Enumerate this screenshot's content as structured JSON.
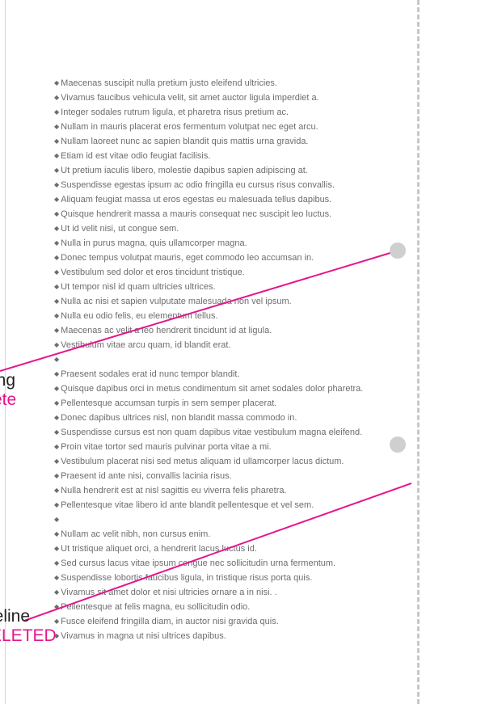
{
  "document": {
    "bullet_glyph": "◆",
    "bullets": [
      "Maecenas suscipit nulla pretium justo eleifend ultricies.",
      "Vivamus faucibus vehicula velit, sit amet auctor ligula imperdiet a.",
      "Integer sodales rutrum ligula, et pharetra risus pretium ac.",
      "Nullam in mauris placerat eros fermentum volutpat nec eget arcu.",
      "Nullam laoreet nunc ac sapien blandit quis mattis urna gravida.",
      "Etiam id est vitae odio feugiat facilisis.",
      "Ut pretium iaculis libero, molestie dapibus sapien adipiscing at.",
      "Suspendisse egestas ipsum ac odio fringilla eu cursus risus convallis.",
      "Aliquam feugiat massa ut eros egestas eu malesuada tellus dapibus.",
      "Quisque hendrerit massa a mauris consequat nec suscipit leo luctus.",
      "Ut id velit nisi, ut congue sem.",
      "Nulla in purus magna, quis ullamcorper magna.",
      "Donec tempus volutpat mauris, eget commodo leo accumsan in.",
      "Vestibulum sed dolor et eros tincidunt tristique.",
      "Ut tempor nisl id quam ultricies ultrices.",
      "Nulla ac nisi et sapien vulputate malesuada non vel ipsum.",
      "Nulla eu odio felis, eu elementum tellus.",
      "Maecenas ac velit a leo hendrerit tincidunt id at ligula.",
      "Vestibulum vitae arcu quam, id blandit erat.",
      "",
      "Praesent sodales erat id nunc tempor blandit.",
      "Quisque dapibus orci in metus condimentum sit amet sodales dolor pharetra.",
      "Pellentesque accumsan turpis in sem semper placerat.",
      "Donec dapibus ultrices nisl, non blandit massa commodo in.",
      "Suspendisse cursus est non quam dapibus vitae vestibulum magna eleifend.",
      "Proin vitae tortor sed mauris pulvinar porta vitae a mi.",
      "Vestibulum placerat nisi sed metus aliquam id ullamcorper lacus dictum.",
      "Praesent id ante nisi, convallis lacinia risus.",
      "Nulla hendrerit est at nisl sagittis eu viverra felis pharetra.",
      "Pellentesque vitae libero id ante blandit pellentesque et vel sem.",
      "",
      "Nullam ac velit nibh, non cursus enim.",
      "Ut tristique aliquet orci, a hendrerit lacus luctus id.",
      "Sed cursus lacus vitae ipsum congue nec sollicitudin urna fermentum.",
      "Suspendisse lobortis faucibus ligula, in tristique risus porta quis.",
      "Vivamus sit amet dolor et nisi ultricies ornare a in nisi. .",
      "Pellentesque at felis magna, eu sollicitudin odio.",
      "Fusce eleifend fringilla diam, in auctor nisi gravida quis.",
      "Vivamus in magna ut nisi ultrices dapibus."
    ]
  },
  "annotations": {
    "top": {
      "lead": "ing",
      "tag": "ete"
    },
    "bottom": {
      "lead": "leline",
      "tag": "ELETED"
    }
  },
  "colors": {
    "accent": "#e5158c",
    "body_text": "#6d6d6d",
    "margin_line": "#c8c8c8",
    "anchor": "#cfcfcf"
  }
}
